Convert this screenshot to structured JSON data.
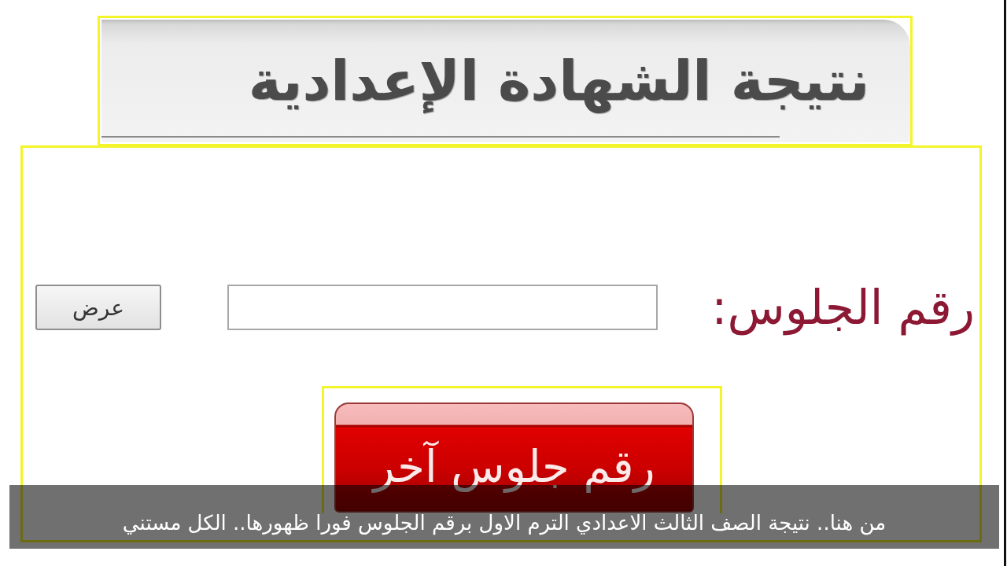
{
  "header": {
    "title": "نتيجة الشهادة الإعدادية"
  },
  "search_form": {
    "label": "رقم الجلوس:",
    "submit_button": "عرض"
  },
  "other_seat_button": "رقم جلوس آخر",
  "caption": "من هنا.. نتيجة الصف الثالث الاعدادي الترم الاول برقم الجلوس فورا ظهورها.. الكل مستني"
}
